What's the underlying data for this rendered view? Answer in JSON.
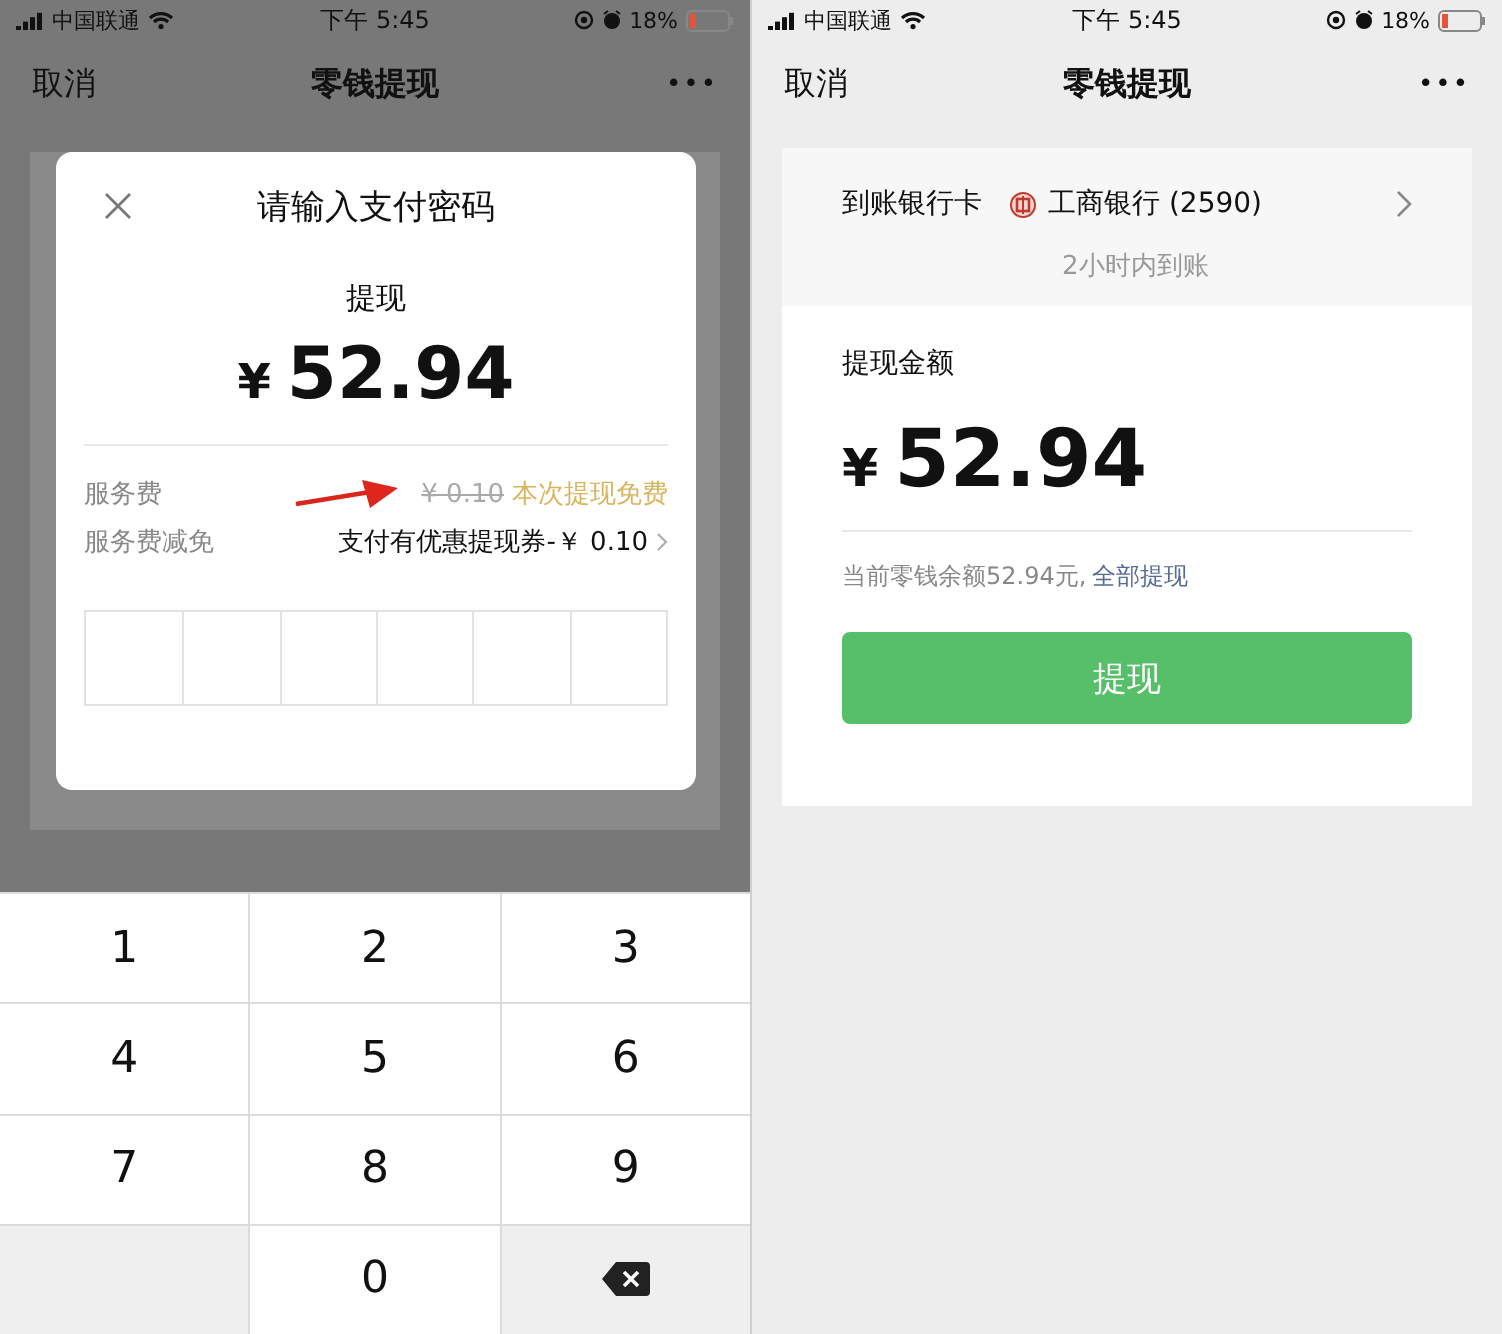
{
  "screens": [
    {
      "status_bar": {
        "carrier": "中国联通",
        "time": "下午 5:45",
        "battery": "18%"
      },
      "nav": {
        "cancel": "取消",
        "title": "零钱提现",
        "more": "•••"
      },
      "dialog": {
        "title": "请输入支付密码",
        "label": "提现",
        "currency": "¥",
        "amount": "52.94",
        "fees": [
          {
            "label": "服务费",
            "old_value": "¥ 0.10",
            "struck": true,
            "note": "本次提现免费",
            "annotated": true,
            "chevron": false
          },
          {
            "label": "服务费减免",
            "value": "支付有优惠提现券-￥ 0.10",
            "annotated": false,
            "chevron": true
          }
        ],
        "password_cells": [
          {
            "filled": false
          },
          {
            "filled": false
          },
          {
            "filled": false
          },
          {
            "filled": false
          },
          {
            "filled": false
          },
          {
            "filled": false
          }
        ]
      },
      "keypad": [
        {
          "kind": "digit",
          "label": "1"
        },
        {
          "kind": "digit",
          "label": "2"
        },
        {
          "kind": "digit",
          "label": "3"
        },
        {
          "kind": "digit",
          "label": "4"
        },
        {
          "kind": "digit",
          "label": "5"
        },
        {
          "kind": "digit",
          "label": "6"
        },
        {
          "kind": "digit",
          "label": "7"
        },
        {
          "kind": "digit",
          "label": "8"
        },
        {
          "kind": "digit",
          "label": "9"
        },
        {
          "kind": "blank"
        },
        {
          "kind": "digit",
          "label": "0"
        },
        {
          "kind": "delete"
        }
      ]
    },
    {
      "status_bar": {
        "carrier": "中国联通",
        "time": "下午 5:45",
        "battery": "18%"
      },
      "nav": {
        "cancel": "取消",
        "title": "零钱提现",
        "more": "•••"
      },
      "bank": {
        "label": "到账银行卡",
        "name": "工商银行 (2590)",
        "eta": "2小时内到账"
      },
      "withdraw": {
        "label": "提现金额",
        "currency": "¥",
        "amount": "52.94",
        "balance": "当前零钱余额52.94元,",
        "all_link": "全部提现",
        "button": "提现"
      }
    }
  ]
}
